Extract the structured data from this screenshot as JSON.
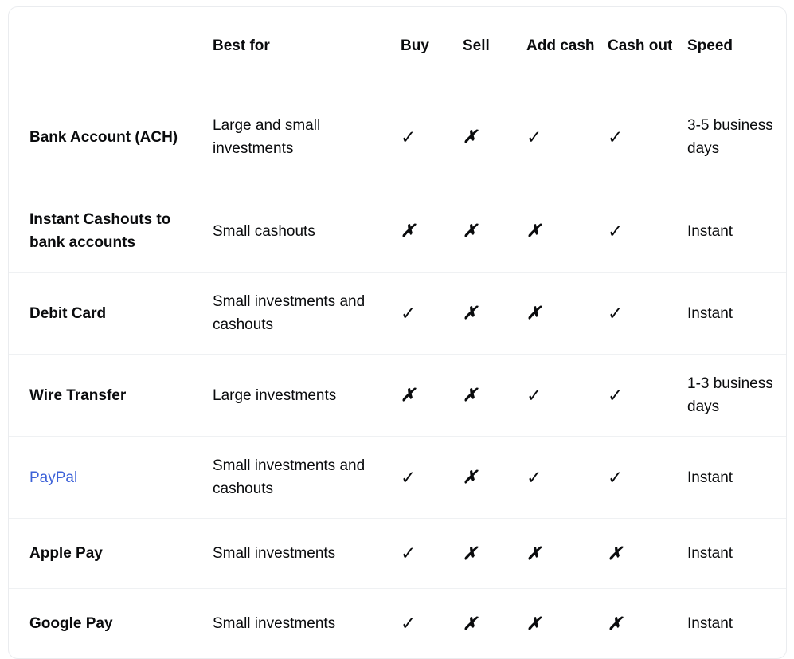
{
  "table": {
    "columns": [
      {
        "key": "method",
        "label": ""
      },
      {
        "key": "bestfor",
        "label": "Best for"
      },
      {
        "key": "buy",
        "label": "Buy"
      },
      {
        "key": "sell",
        "label": "Sell"
      },
      {
        "key": "addcash",
        "label": "Add cash"
      },
      {
        "key": "cashout",
        "label": "Cash out"
      },
      {
        "key": "speed",
        "label": "Speed"
      }
    ],
    "marks": {
      "yes": "✓",
      "no": "✗",
      "yes_name": "check-icon",
      "no_name": "cross-icon"
    },
    "link_color": "#3c61d8",
    "border_color": "#eaecef",
    "text_color": "#0a0b0d",
    "rows": [
      {
        "method": "Bank Account (ACH)",
        "is_link": false,
        "bestfor": "Large and small investments",
        "buy": "✓",
        "sell": "✗",
        "addcash": "✓",
        "cashout": "✓",
        "speed": "3-5 business days"
      },
      {
        "method": "Instant Cashouts to bank accounts",
        "is_link": false,
        "bestfor": "Small cashouts",
        "buy": "✗",
        "sell": "✗",
        "addcash": "✗",
        "cashout": "✓",
        "speed": "Instant"
      },
      {
        "method": "Debit Card",
        "is_link": false,
        "bestfor": "Small investments and cashouts",
        "buy": "✓",
        "sell": "✗",
        "addcash": "✗",
        "cashout": "✓",
        "speed": "Instant"
      },
      {
        "method": "Wire Transfer",
        "is_link": false,
        "bestfor": "Large investments",
        "buy": "✗",
        "sell": "✗",
        "addcash": "✓",
        "cashout": "✓",
        "speed": "1-3 business days"
      },
      {
        "method": "PayPal",
        "is_link": true,
        "bestfor": "Small investments and cashouts",
        "buy": "✓",
        "sell": "✗",
        "addcash": "✓",
        "cashout": "✓",
        "speed": "Instant"
      },
      {
        "method": "Apple Pay",
        "is_link": false,
        "bestfor": "Small investments",
        "buy": "✓",
        "sell": "✗",
        "addcash": "✗",
        "cashout": "✗",
        "speed": "Instant"
      },
      {
        "method": "Google Pay",
        "is_link": false,
        "bestfor": "Small investments",
        "buy": "✓",
        "sell": "✗",
        "addcash": "✗",
        "cashout": "✗",
        "speed": "Instant"
      }
    ]
  }
}
